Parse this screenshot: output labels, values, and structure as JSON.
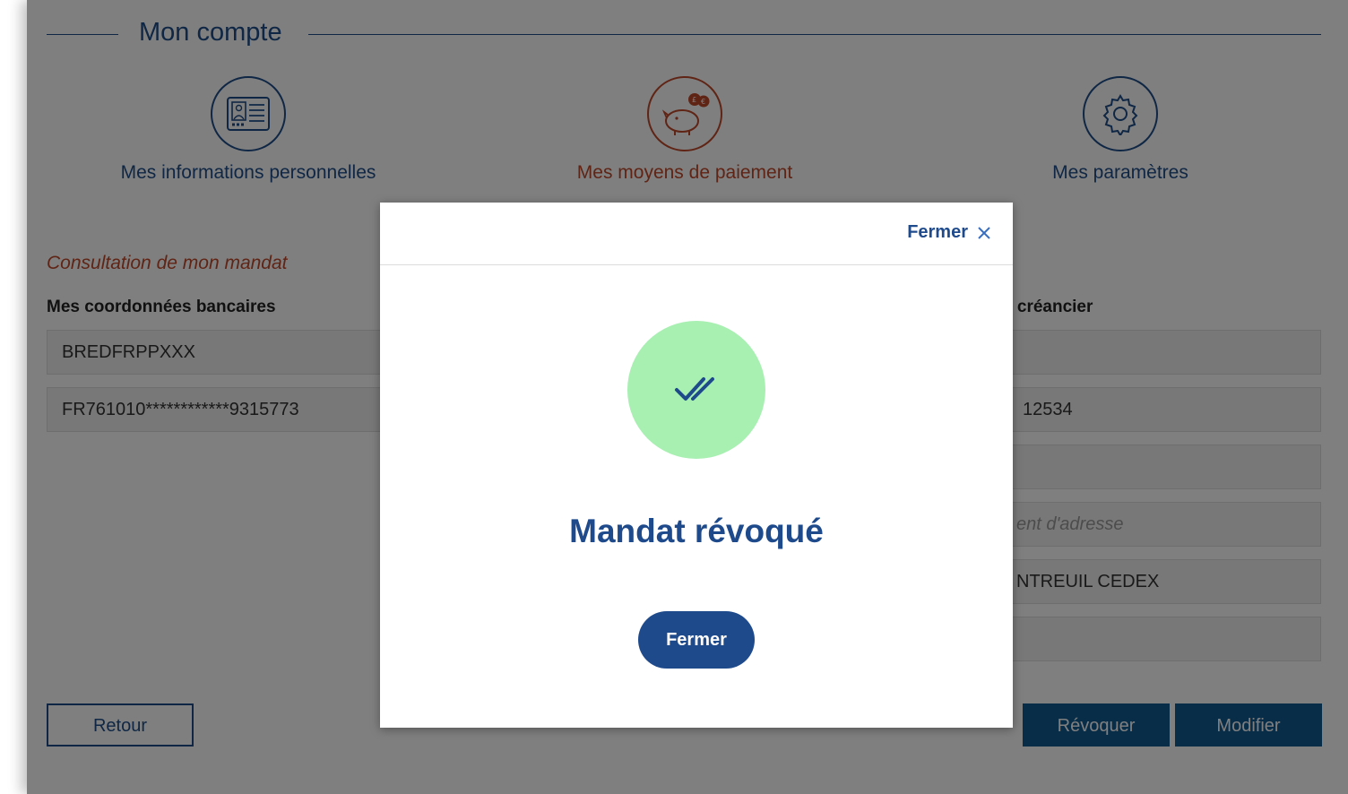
{
  "section": {
    "title": "Mon compte"
  },
  "nav": [
    {
      "label": "Mes informations personnelles",
      "icon": "id-card-icon",
      "active": false
    },
    {
      "label": "Mes moyens de paiement",
      "icon": "piggy-bank-icon",
      "active": true
    },
    {
      "label": "Mes paramètres",
      "icon": "gear-icon",
      "active": false
    }
  ],
  "mandate": {
    "consultation_title": "Consultation de mon mandat",
    "bank_heading": "Mes coordonnées bancaires",
    "creditor_heading_partial": "n créancier",
    "bank_fields": [
      "BREDFRPPXXX",
      "FR761010************9315773"
    ],
    "creditor_fields": [
      "",
      "12534",
      "",
      "ent d'adresse",
      "NTREUIL CEDEX",
      ""
    ]
  },
  "buttons": {
    "back": "Retour",
    "revoke": "Révoquer",
    "edit": "Modifier"
  },
  "modal": {
    "close_top": "Fermer",
    "title": "Mandat révoqué",
    "close_button": "Fermer"
  },
  "colors": {
    "primary": "#1f4f8a",
    "accent": "#c0492b",
    "success": "#a8efb2",
    "button": "#0e5a93"
  }
}
